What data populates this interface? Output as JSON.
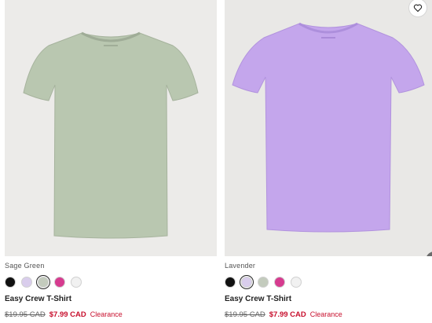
{
  "products": [
    {
      "color_name": "Sage Green",
      "name": "Easy Crew T-Shirt",
      "original_price": "$19.95 CAD",
      "sale_price": "$7.99 CAD",
      "badge": "Clearance",
      "shirt_color": "#b9c7b0",
      "swatches": [
        {
          "color": "#111111",
          "selected": false
        },
        {
          "color": "#d9cdec",
          "selected": false
        },
        {
          "color": "#c3cbbd",
          "selected": true
        },
        {
          "color": "#d63b8f",
          "selected": false
        },
        {
          "color": "#f1f1f1",
          "selected": false
        }
      ]
    },
    {
      "color_name": "Lavender",
      "name": "Easy Crew T-Shirt",
      "original_price": "$19.95 CAD",
      "sale_price": "$7.99 CAD",
      "badge": "Clearance",
      "shirt_color": "#c4a6ec",
      "swatches": [
        {
          "color": "#111111",
          "selected": false
        },
        {
          "color": "#d9cdec",
          "selected": true
        },
        {
          "color": "#c3cbbd",
          "selected": false
        },
        {
          "color": "#d63b8f",
          "selected": false
        },
        {
          "color": "#f1f1f1",
          "selected": false
        }
      ]
    }
  ],
  "icons": {
    "favorite": "heart-outline-icon"
  },
  "colors": {
    "sale": "#c8102e",
    "text": "#222222"
  }
}
